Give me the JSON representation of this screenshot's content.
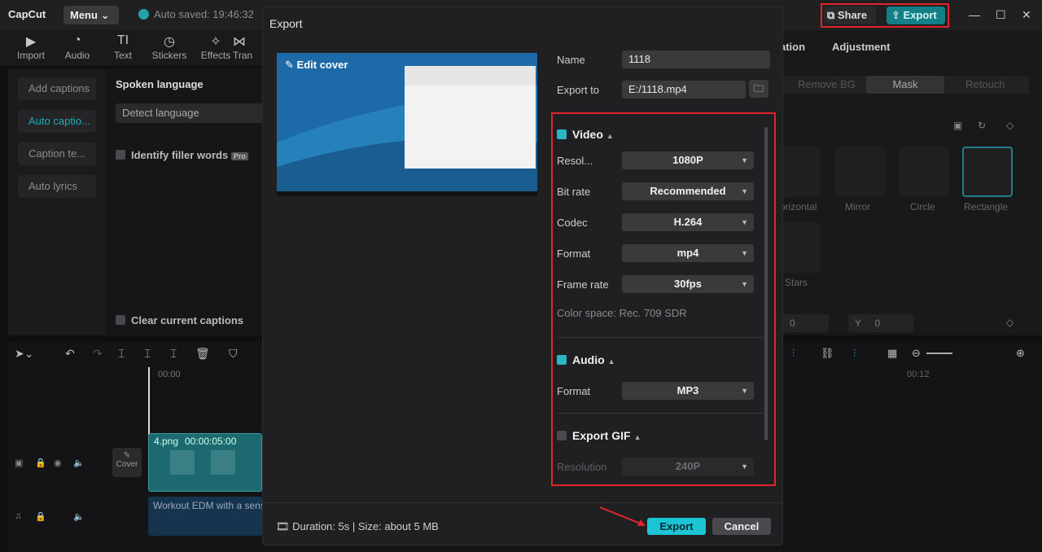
{
  "app": {
    "logo": "CapCut",
    "menu_label": "Menu",
    "autosave": "Auto saved: 19:46:32",
    "share_label": "Share",
    "export_label": "Export"
  },
  "toolbar": {
    "items": [
      "Import",
      "Audio",
      "Text",
      "Stickers",
      "Effects",
      "Tran"
    ]
  },
  "left": {
    "buttons": [
      "Add captions",
      "Auto captio...",
      "Caption te...",
      "Auto lyrics"
    ]
  },
  "middle": {
    "spoken_language": "Spoken language",
    "detect_language": "Detect language",
    "filler_words": "Identify filler words",
    "pro_badge": "Pro",
    "clear_captions": "Clear current captions"
  },
  "right": {
    "tab_partial": "ation",
    "tab_adjustment": "Adjustment",
    "sub_tabs": [
      "Remove BG",
      "Mask",
      "Retouch"
    ],
    "shapes": [
      "orizontal",
      "Mirror",
      "Circle",
      "Rectangle",
      "Stars"
    ],
    "x_val": "0",
    "y_label": "Y",
    "y_val": "0"
  },
  "timeline": {
    "time_start": "00:00",
    "time_12": "00:12",
    "clip_name": "4.png",
    "clip_duration": "00:00:05:00",
    "audio_name": "Workout EDM with a sens",
    "cover_label": "Cover"
  },
  "dialog": {
    "title": "Export",
    "edit_cover": "Edit cover",
    "name_label": "Name",
    "name_value": "1118",
    "export_to_label": "Export to",
    "export_to_value": "E:/1118.mp4",
    "video_section": "Video",
    "resolution_label": "Resol...",
    "resolution_value": "1080P",
    "bitrate_label": "Bit rate",
    "bitrate_value": "Recommended",
    "codec_label": "Codec",
    "codec_value": "H.264",
    "format_label": "Format",
    "format_value": "mp4",
    "framerate_label": "Frame rate",
    "framerate_value": "30fps",
    "color_space": "Color space: Rec. 709 SDR",
    "audio_section": "Audio",
    "audio_format_label": "Format",
    "audio_format_value": "MP3",
    "gif_section": "Export GIF",
    "gif_resolution_label": "Resolution",
    "gif_resolution_value": "240P",
    "info": "Duration: 5s | Size: about 5 MB",
    "export_button": "Export",
    "cancel_button": "Cancel"
  },
  "colors": {
    "accent": "#1cc4d4",
    "highlight": "#e0242a"
  }
}
